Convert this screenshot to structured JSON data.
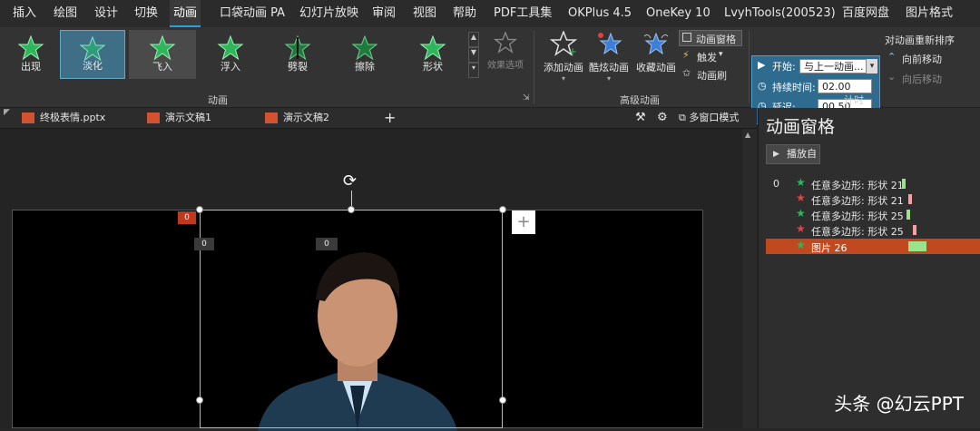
{
  "menu": {
    "items": [
      "插入",
      "绘图",
      "设计",
      "切换",
      "动画",
      "口袋动画 PA",
      "幻灯片放映",
      "审阅",
      "视图",
      "帮助",
      "PDF工具集",
      "OKPlus 4.5",
      "OneKey 10",
      "LvyhTools(200523)",
      "百度网盘",
      "图片格式"
    ],
    "active": "动画"
  },
  "ribbon": {
    "animations": [
      {
        "label": "出现"
      },
      {
        "label": "淡化"
      },
      {
        "label": "飞入"
      },
      {
        "label": "浮入"
      },
      {
        "label": "劈裂"
      },
      {
        "label": "擦除"
      },
      {
        "label": "形状"
      }
    ],
    "effect_options": "效果选项",
    "group_animation": "动画",
    "add_animation": "添加动画",
    "cool_animation": "酷炫动画",
    "fav_animation": "收藏动画",
    "anim_pane_btn": "动画窗格",
    "trigger": "触发",
    "anim_brush": "动画刷",
    "group_advanced": "高级动画",
    "timing": {
      "start_label": "开始:",
      "start_value": "与上一动画...",
      "duration_label": "持续时间:",
      "duration_value": "02.00",
      "delay_label": "延迟:",
      "delay_value": "00.50"
    },
    "reorder_title": "对动画重新排序",
    "move_forward": "向前移动",
    "move_back": "向后移动",
    "group_timing": "计时",
    "accent": "#2ea0d8"
  },
  "tabs": {
    "docs": [
      "终极表情.pptx",
      "演示文稿1",
      "演示文稿2"
    ],
    "add": "+",
    "multi_window": "多窗口模式"
  },
  "slide": {
    "tags": [
      "0",
      "0",
      "0"
    ],
    "plus": "+"
  },
  "pane": {
    "title": "动画窗格",
    "play": "播放自",
    "index": "0",
    "rows": [
      {
        "label": "任意多边形: 形状 21",
        "star": "green",
        "bar_color": "#9be38a"
      },
      {
        "label": "任意多边形: 形状 21",
        "star": "red",
        "bar_color": "#f5a0a0"
      },
      {
        "label": "任意多边形: 形状 25",
        "star": "green",
        "bar_color": "#9be38a"
      },
      {
        "label": "任意多边形: 形状 25",
        "star": "red",
        "bar_color": "#f5a0a0"
      },
      {
        "label": "图片 26",
        "star": "green",
        "bar_color": "#9be38a"
      }
    ]
  },
  "watermark": "头条 @幻云PPT"
}
